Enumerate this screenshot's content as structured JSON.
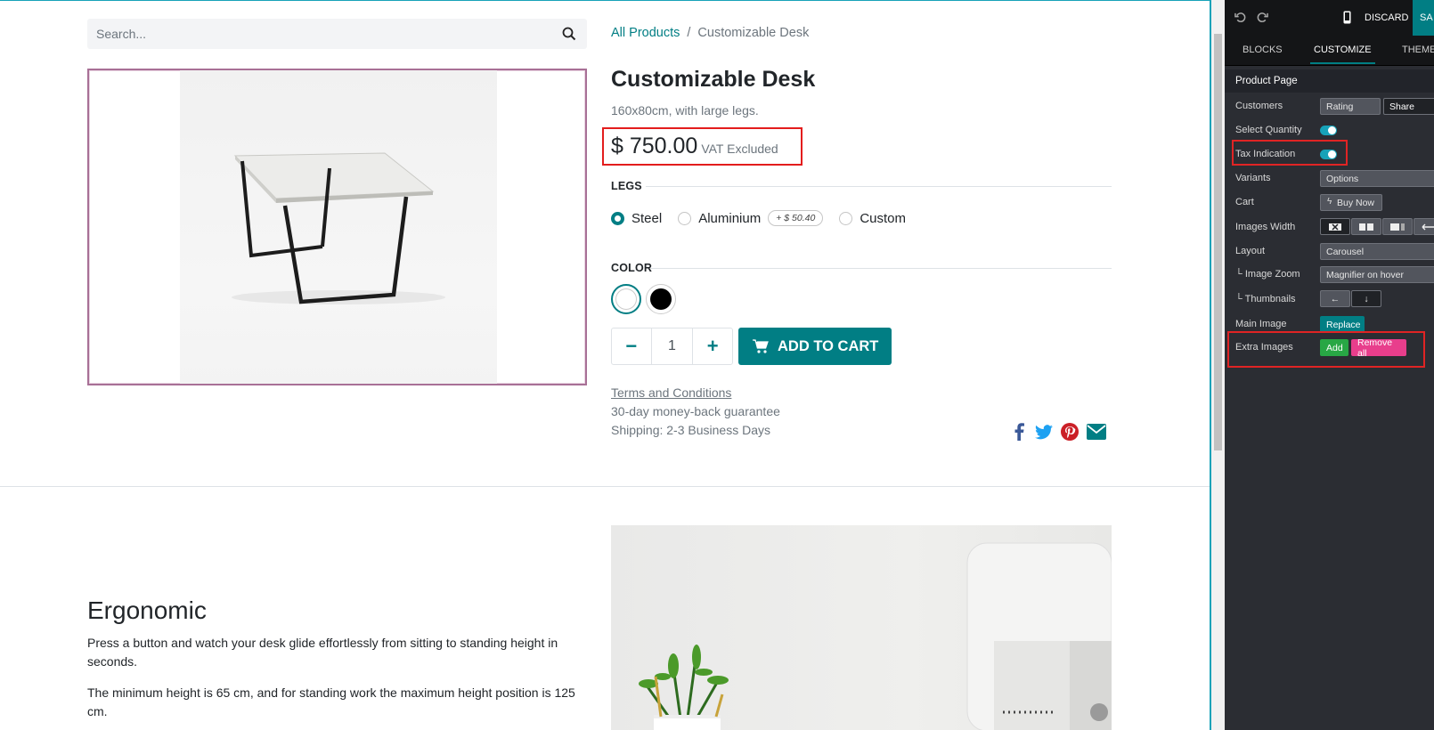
{
  "search": {
    "placeholder": "Search..."
  },
  "breadcrumb": {
    "parent": "All Products",
    "separator": "/",
    "current": "Customizable Desk"
  },
  "product": {
    "name": "Customizable Desk",
    "description": "160x80cm, with large legs.",
    "price": "$ 750.00",
    "tax_note": "VAT Excluded"
  },
  "legs": {
    "title": "LEGS",
    "options": [
      "Steel",
      "Aluminium",
      "Custom"
    ],
    "selected": "Steel",
    "aluminium_extra": "+ $ 50.40"
  },
  "color": {
    "title": "COLOR",
    "swatches": [
      "#ffffff",
      "#000000"
    ],
    "selected": "#ffffff"
  },
  "cart": {
    "minus": "−",
    "quantity": "1",
    "plus": "+",
    "add_label": "ADD TO CART"
  },
  "info": {
    "terms": "Terms and Conditions",
    "guarantee": "30-day money-back guarantee",
    "shipping": "Shipping: 2-3 Business Days"
  },
  "share_icons": [
    "facebook-icon",
    "twitter-icon",
    "pinterest-icon",
    "email-icon"
  ],
  "section": {
    "title": "Ergonomic",
    "p1": "Press a button and watch your desk glide effortlessly from sitting to standing height in seconds.",
    "p2": "The minimum height is 65 cm, and for standing work the maximum height position is 125 cm."
  },
  "editor": {
    "discard": "DISCARD",
    "save": "SA",
    "tabs": [
      "BLOCKS",
      "CUSTOMIZE",
      "THEME"
    ],
    "active_tab": "CUSTOMIZE",
    "section_title": "Product Page",
    "rows": {
      "customers": "Customers",
      "customers_opts": [
        "Rating",
        "Share"
      ],
      "select_quantity": "Select Quantity",
      "tax_indication": "Tax Indication",
      "variants": "Variants",
      "variants_value": "Options",
      "cart": "Cart",
      "cart_value": "Buy Now",
      "images_width": "Images Width",
      "layout": "Layout",
      "layout_value": "Carousel",
      "image_zoom": "└ Image Zoom",
      "image_zoom_value": "Magnifier on hover",
      "thumbnails": "└ Thumbnails",
      "main_image": "Main Image",
      "main_image_btn": "Replace",
      "extra_images": "Extra Images",
      "extra_add": "Add",
      "extra_remove": "Remove all"
    },
    "colors": {
      "accent": "#017e84",
      "toggle": "#17a2b8",
      "add": "#28a745",
      "remove": "#e83e8c",
      "highlight": "#e02424"
    }
  }
}
